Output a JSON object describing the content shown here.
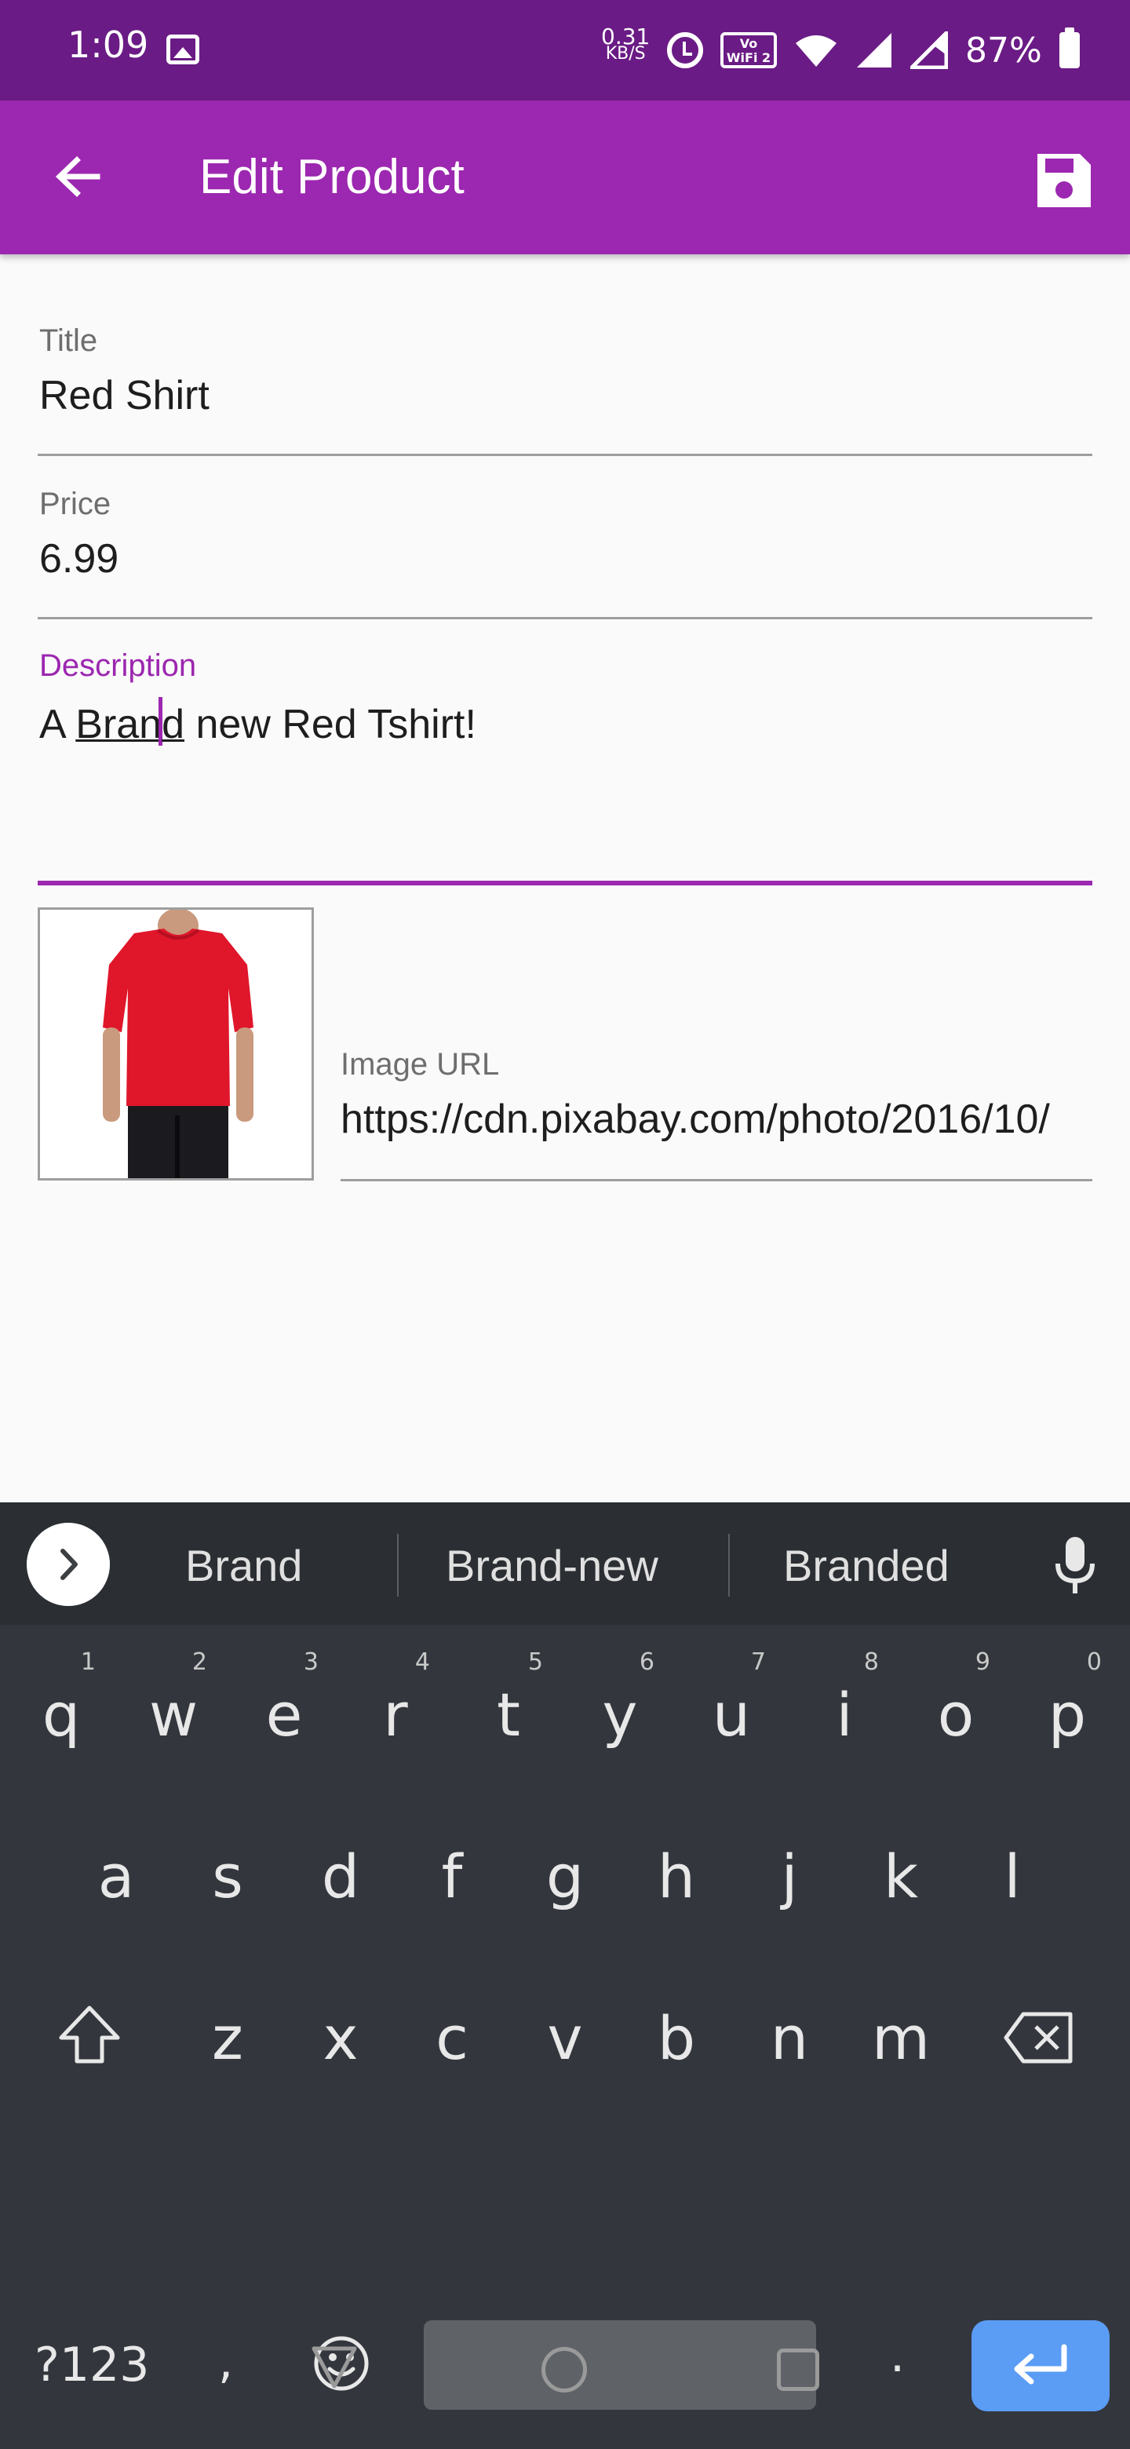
{
  "status_bar": {
    "time": "1:09",
    "data_rate_value": "0.31",
    "data_rate_unit": "KB/S",
    "volte_label": "Vo WiFi 2",
    "battery_percent": "87%"
  },
  "app_bar": {
    "title": "Edit Product",
    "back_icon": "arrow-back-icon",
    "save_icon": "save-icon"
  },
  "form": {
    "title": {
      "label": "Title",
      "value": "Red Shirt"
    },
    "price": {
      "label": "Price",
      "value": "6.99"
    },
    "description": {
      "label": "Description",
      "value_prefix": "A ",
      "value_word_before_cursor": "Bran",
      "value_word_after_cursor": "d",
      "value_suffix": " new Red Tshirt!"
    },
    "image_url": {
      "label": "Image URL",
      "value": "https://cdn.pixabay.com/photo/2016/10/"
    }
  },
  "keyboard": {
    "suggestions": [
      "Brand",
      "Brand-new",
      "Branded"
    ],
    "row1": [
      {
        "key": "q",
        "hint": "1"
      },
      {
        "key": "w",
        "hint": "2"
      },
      {
        "key": "e",
        "hint": "3"
      },
      {
        "key": "r",
        "hint": "4"
      },
      {
        "key": "t",
        "hint": "5"
      },
      {
        "key": "y",
        "hint": "6"
      },
      {
        "key": "u",
        "hint": "7"
      },
      {
        "key": "i",
        "hint": "8"
      },
      {
        "key": "o",
        "hint": "9"
      },
      {
        "key": "p",
        "hint": "0"
      }
    ],
    "row2": [
      "a",
      "s",
      "d",
      "f",
      "g",
      "h",
      "j",
      "k",
      "l"
    ],
    "row3": [
      "z",
      "x",
      "c",
      "v",
      "b",
      "n",
      "m"
    ],
    "symbols_label": "?123",
    "comma": ",",
    "period": ".",
    "enter_color": "#5b9cf5"
  },
  "colors": {
    "primary": "#9c27b0",
    "primary_dark": "#6a1b85",
    "keyboard_bg": "#33373d"
  }
}
